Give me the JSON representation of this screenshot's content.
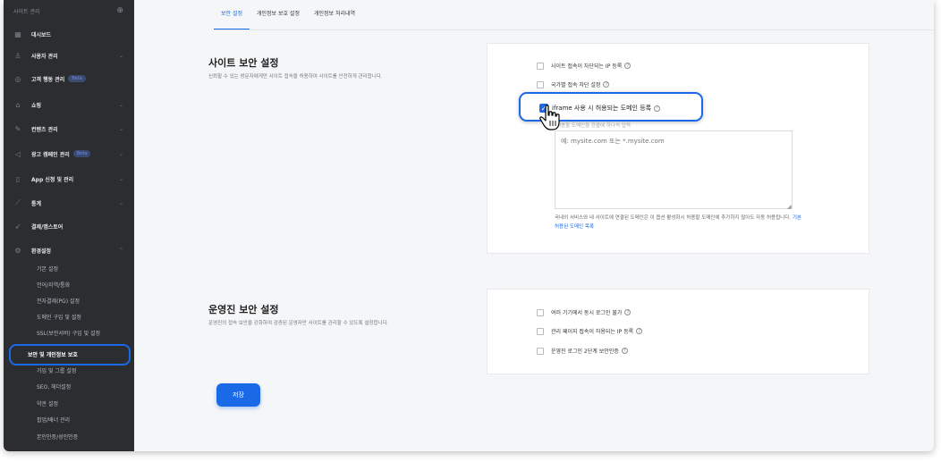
{
  "sidebar": {
    "header": "사이트 관리",
    "header_icon": "plus-circle-icon",
    "items": [
      {
        "label": "대시보드",
        "icon": "dashboard-icon"
      },
      {
        "label": "사용자 관리",
        "icon": "user-icon"
      },
      {
        "label": "고객 행동 관리",
        "icon": "target-icon",
        "badge": "Beta"
      },
      {
        "label": "쇼핑",
        "icon": "bag-icon"
      },
      {
        "label": "컨텐츠 관리",
        "icon": "edit-icon"
      },
      {
        "label": "광고 캠페인 관리",
        "icon": "megaphone-icon",
        "badge": "Beta"
      },
      {
        "label": "App 신청 및 관리",
        "icon": "phone-icon"
      },
      {
        "label": "통계",
        "icon": "chart-icon"
      },
      {
        "label": "결제/앱스토어",
        "icon": "rocket-icon"
      },
      {
        "label": "환경설정",
        "icon": "gear-icon"
      }
    ],
    "subitems": [
      "기본 설정",
      "언어/지역/통화",
      "전자결제(PG) 설정",
      "도메인 구입 및 설정",
      "SSL(보안서버) 구입 및 설정",
      "보안 및 개인정보 보호",
      "가입 및 그룹 설정",
      "SEO, 헤더설정",
      "약관 설정",
      "팝업/배너 관리",
      "본인인증/성인인증"
    ],
    "active_sub": "보안 및 개인정보 보호"
  },
  "tabs": [
    "보안 설정",
    "개인정보 보호 설정",
    "개인정보 처리내역"
  ],
  "site_security": {
    "title": "사이트 보안 설정",
    "desc": "신뢰할 수 있는 방문자에게만 사이트 접속을 허용하여 사이트를 안전하게 관리합니다.",
    "options": [
      {
        "label": "사이트 접속이 차단되는 IP 등록",
        "checked": false
      },
      {
        "label": "국가별 접속 차단 설정",
        "checked": false
      },
      {
        "label": "iframe 사용 시 허용되는 도메인 등록",
        "checked": true
      }
    ],
    "textarea_hint": "허용할 도메인을 한줄에 하나씩 입력",
    "textarea_placeholder": "예: mysite.com 또는 *.mysite.com",
    "note": "국내외 서비스와 내 사이트에 연결된 도메인은 이 옵션 활성화시 허용할 도메인에 추가하지 않아도 자동 허용됩니다.",
    "note_link": "기본 허용된 도메인 목록"
  },
  "admin_security": {
    "title": "운영진 보안 설정",
    "desc": "운영진의 접속 보안을 강화하여 검증된 운영자만 사이트를 관리할 수 있도록 설정합니다.",
    "options": [
      {
        "label": "여러 기기에서 동시 로그인 불가",
        "checked": false
      },
      {
        "label": "관리 페이지 접속이 허용되는 IP 등록",
        "checked": false
      },
      {
        "label": "운영진 로그인 2단계 보안인증",
        "checked": false
      }
    ]
  },
  "save_label": "저장",
  "colors": {
    "accent": "#1a6ae8",
    "sidebar_bg": "#2b2d31"
  }
}
